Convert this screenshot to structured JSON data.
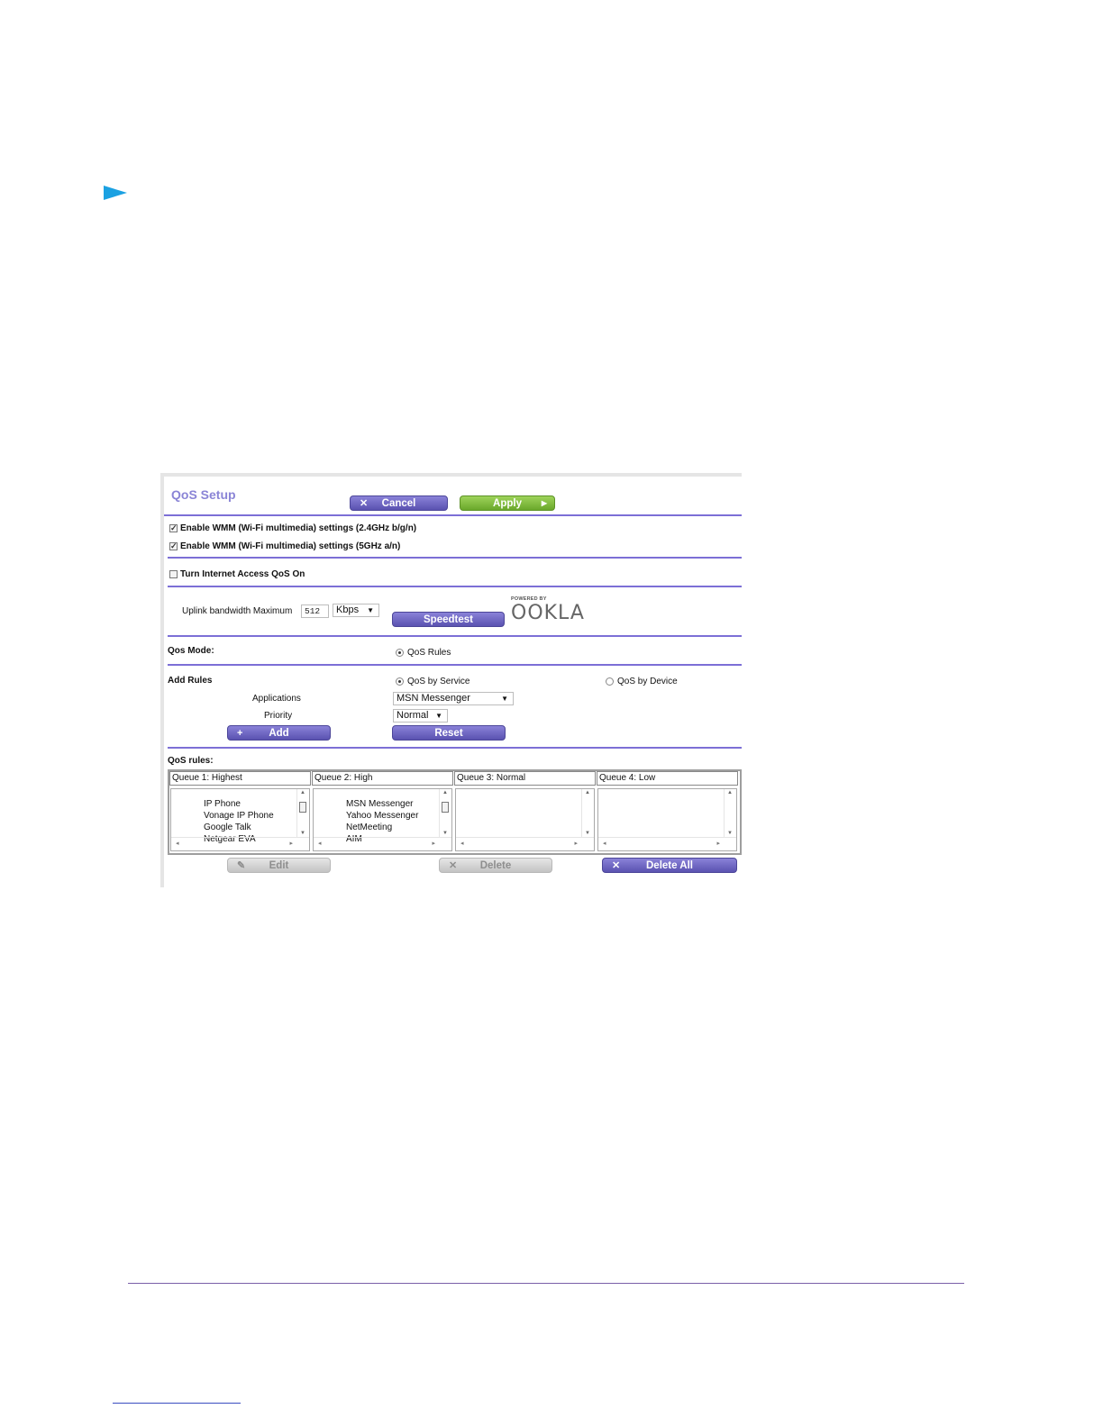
{
  "panel": {
    "title": "QoS Setup",
    "cancel_label": "Cancel",
    "apply_label": "Apply",
    "wmm_24": "Enable WMM (Wi-Fi multimedia) settings (2.4GHz b/g/n)",
    "wmm_5": "Enable WMM (Wi-Fi multimedia) settings (5GHz a/n)",
    "qos_on": "Turn Internet Access QoS On",
    "uplink_label": "Uplink bandwidth Maximum",
    "uplink_value": "512",
    "uplink_unit": "Kbps",
    "speedtest_label": "Speedtest",
    "ookla_powered": "POWERED BY",
    "ookla_brand": "OOKLA",
    "qos_mode_label": "Qos Mode:",
    "qos_rules_option": "QoS Rules",
    "add_rules_label": "Add Rules",
    "by_service": "QoS by Service",
    "by_device": "QoS by Device",
    "applications_label": "Applications",
    "applications_value": "MSN Messenger",
    "priority_label": "Priority",
    "priority_value": "Normal",
    "add_label": "Add",
    "reset_label": "Reset",
    "qos_rules_label": "QoS rules:",
    "edit_label": "Edit",
    "delete_label": "Delete",
    "delete_all_label": "Delete All"
  },
  "queues": [
    {
      "header": "Queue 1: Highest",
      "items": [
        "IP Phone",
        "Vonage IP Phone",
        "Google Talk",
        "Netgear EVA"
      ]
    },
    {
      "header": "Queue 2: High",
      "items": [
        "MSN Messenger",
        "Yahoo Messenger",
        "NetMeeting",
        "AIM"
      ]
    },
    {
      "header": "Queue 3: Normal",
      "items": []
    },
    {
      "header": "Queue 4: Low",
      "items": []
    }
  ],
  "colors": {
    "accent": "#7c6fd6",
    "button_purple": "#5a52b0",
    "button_green": "#6aa82b",
    "pointer": "#1ba1e2"
  }
}
